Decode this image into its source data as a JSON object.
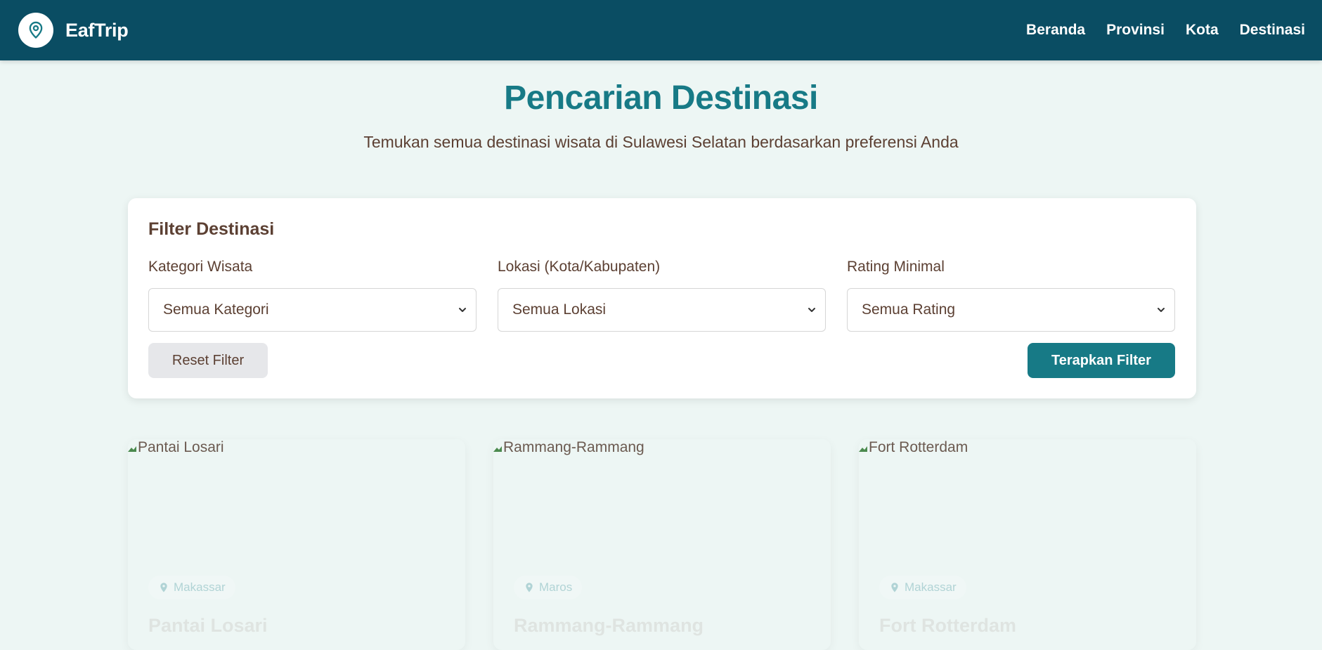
{
  "navbar": {
    "brand": "EafTrip",
    "links": [
      "Beranda",
      "Provinsi",
      "Kota",
      "Destinasi"
    ]
  },
  "header": {
    "title": "Pencarian Destinasi",
    "subtitle": "Temukan semua destinasi wisata di Sulawesi Selatan berdasarkan preferensi Anda"
  },
  "filter": {
    "heading": "Filter Destinasi",
    "fields": [
      {
        "label": "Kategori Wisata",
        "value": "Semua Kategori"
      },
      {
        "label": "Lokasi (Kota/Kabupaten)",
        "value": "Semua Lokasi"
      },
      {
        "label": "Rating Minimal",
        "value": "Semua Rating"
      }
    ],
    "reset_label": "Reset Filter",
    "apply_label": "Terapkan Filter"
  },
  "destinations": [
    {
      "image_alt": "Pantai Losari",
      "location": "Makassar",
      "name": "Pantai Losari"
    },
    {
      "image_alt": "Rammang-Rammang",
      "location": "Maros",
      "name": "Rammang-Rammang"
    },
    {
      "image_alt": "Fort Rotterdam",
      "location": "Makassar",
      "name": "Fort Rotterdam"
    }
  ],
  "colors": {
    "navbar": "#0a4d63",
    "accent": "#177a86",
    "background": "#edf6f4",
    "text": "#5c4033"
  }
}
